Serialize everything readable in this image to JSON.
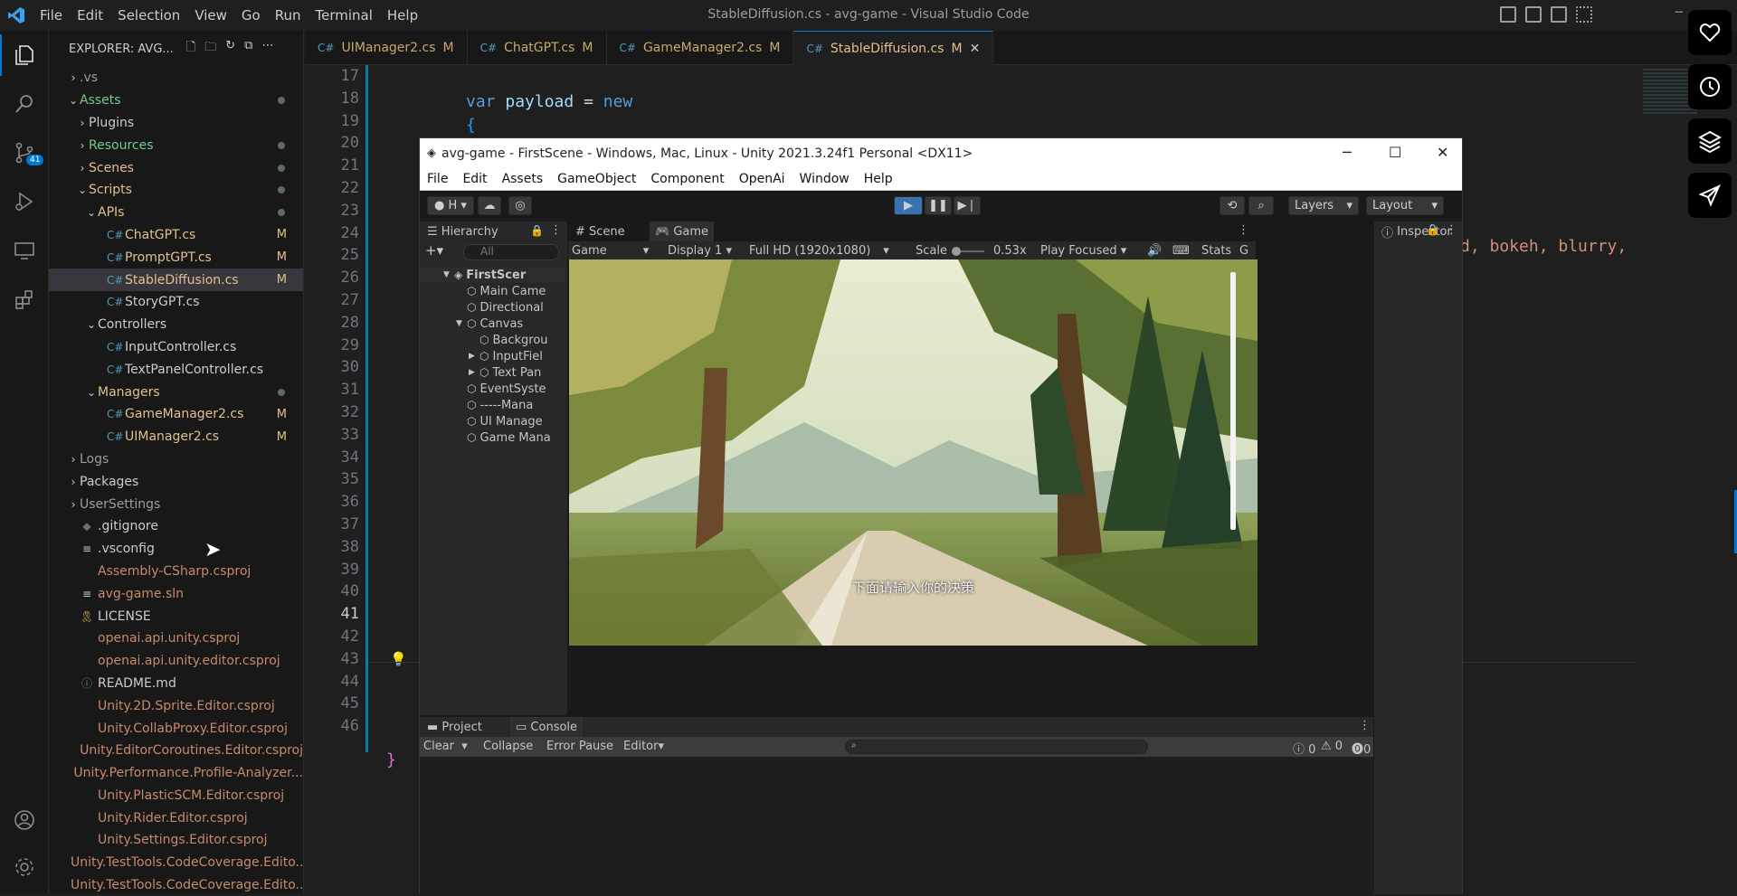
{
  "window": {
    "title": "StableDiffusion.cs - avg-game - Visual Studio Code",
    "menu": [
      "File",
      "Edit",
      "Selection",
      "View",
      "Go",
      "Run",
      "Terminal",
      "Help"
    ]
  },
  "activity": {
    "source_control_badge": "41"
  },
  "explorer": {
    "header": "EXPLORER: AVG...",
    "rows": [
      {
        "label": ".vs",
        "indent": 0,
        "chev": ">",
        "color": "#9d9d9d"
      },
      {
        "label": "Assets",
        "indent": 0,
        "chev": "v",
        "color": "#73c991",
        "dot": true
      },
      {
        "label": "Plugins",
        "indent": 1,
        "chev": ">",
        "color": "#cccccc"
      },
      {
        "label": "Resources",
        "indent": 1,
        "chev": ">",
        "color": "#73c991",
        "dot": true
      },
      {
        "label": "Scenes",
        "indent": 1,
        "chev": ">",
        "color": "#e2c08d",
        "dot": true
      },
      {
        "label": "Scripts",
        "indent": 1,
        "chev": "v",
        "color": "#e2c08d",
        "dot": true
      },
      {
        "label": "APIs",
        "indent": 2,
        "chev": "v",
        "color": "#e2c08d",
        "dot": true
      },
      {
        "label": "ChatGPT.cs",
        "indent": 3,
        "file": "cs",
        "color": "#e2c08d",
        "status": "M"
      },
      {
        "label": "PromptGPT.cs",
        "indent": 3,
        "file": "cs",
        "color": "#e2c08d",
        "status": "M"
      },
      {
        "label": "StableDiffusion.cs",
        "indent": 3,
        "file": "cs",
        "color": "#e2c08d",
        "status": "M",
        "selected": true
      },
      {
        "label": "StoryGPT.cs",
        "indent": 3,
        "file": "cs",
        "color": "#cccccc"
      },
      {
        "label": "Controllers",
        "indent": 2,
        "chev": "v",
        "color": "#cccccc"
      },
      {
        "label": "InputController.cs",
        "indent": 3,
        "file": "cs",
        "color": "#cccccc"
      },
      {
        "label": "TextPanelController.cs",
        "indent": 3,
        "file": "cs",
        "color": "#cccccc"
      },
      {
        "label": "Managers",
        "indent": 2,
        "chev": "v",
        "color": "#e2c08d",
        "dot": true
      },
      {
        "label": "GameManager2.cs",
        "indent": 3,
        "file": "cs",
        "color": "#e2c08d",
        "status": "M"
      },
      {
        "label": "UIManager2.cs",
        "indent": 3,
        "file": "cs",
        "color": "#e2c08d",
        "status": "M"
      },
      {
        "label": "Logs",
        "indent": 0,
        "chev": ">",
        "color": "#9d9d9d"
      },
      {
        "label": "Packages",
        "indent": 0,
        "chev": ">",
        "color": "#cccccc"
      },
      {
        "label": "UserSettings",
        "indent": 0,
        "chev": ">",
        "color": "#9d9d9d"
      },
      {
        "label": ".gitignore",
        "indent": 0,
        "file": "git",
        "color": "#cccccc"
      },
      {
        "label": ".vsconfig",
        "indent": 0,
        "file": "txt",
        "color": "#cccccc"
      },
      {
        "label": "Assembly-CSharp.csproj",
        "indent": 0,
        "file": "proj",
        "color": "#c78a6a"
      },
      {
        "label": "avg-game.sln",
        "indent": 0,
        "file": "txt",
        "color": "#c78a6a"
      },
      {
        "label": "LICENSE",
        "indent": 0,
        "file": "lic",
        "color": "#cccccc"
      },
      {
        "label": "openai.api.unity.csproj",
        "indent": 0,
        "file": "proj",
        "color": "#c78a6a"
      },
      {
        "label": "openai.api.unity.editor.csproj",
        "indent": 0,
        "file": "proj",
        "color": "#c78a6a"
      },
      {
        "label": "README.md",
        "indent": 0,
        "file": "info",
        "color": "#cccccc"
      },
      {
        "label": "Unity.2D.Sprite.Editor.csproj",
        "indent": 0,
        "file": "proj",
        "color": "#c78a6a"
      },
      {
        "label": "Unity.CollabProxy.Editor.csproj",
        "indent": 0,
        "file": "proj",
        "color": "#c78a6a"
      },
      {
        "label": "Unity.EditorCoroutines.Editor.csproj",
        "indent": 0,
        "file": "proj",
        "color": "#c78a6a"
      },
      {
        "label": "Unity.Performance.Profile-Analyzer...",
        "indent": 0,
        "file": "proj",
        "color": "#c78a6a"
      },
      {
        "label": "Unity.PlasticSCM.Editor.csproj",
        "indent": 0,
        "file": "proj",
        "color": "#c78a6a"
      },
      {
        "label": "Unity.Rider.Editor.csproj",
        "indent": 0,
        "file": "proj",
        "color": "#c78a6a"
      },
      {
        "label": "Unity.Settings.Editor.csproj",
        "indent": 0,
        "file": "proj",
        "color": "#c78a6a"
      },
      {
        "label": "Unity.TestTools.CodeCoverage.Edito...",
        "indent": 0,
        "file": "proj",
        "color": "#c78a6a"
      },
      {
        "label": "Unity.TestTools.CodeCoverage.Edito...",
        "indent": 0,
        "file": "proj",
        "color": "#c78a6a"
      }
    ]
  },
  "tabs": [
    {
      "label": "UIManager2.cs",
      "mark": "M"
    },
    {
      "label": "ChatGPT.cs",
      "mark": "M"
    },
    {
      "label": "GameManager2.cs",
      "mark": "M"
    },
    {
      "label": "StableDiffusion.cs",
      "mark": "M",
      "active": true,
      "close": "✕"
    }
  ],
  "editor": {
    "line_numbers": [
      "17",
      "18",
      "19",
      "20",
      "21",
      "22",
      "23",
      "24",
      "25",
      "26",
      "27",
      "28",
      "29",
      "30",
      "31",
      "32",
      "33",
      "34",
      "35",
      "36",
      "37",
      "38",
      "39",
      "40",
      "41",
      "42",
      "43",
      "44",
      "45",
      "46"
    ],
    "current_line": "41",
    "code_line_18": {
      "kw": "var",
      "name": "payload",
      "eq": "=",
      "new": "new"
    },
    "code_line_19": "{",
    "code_line_24_tail": "d, bokeh, blurry,",
    "code_line_45": "}"
  },
  "unity": {
    "title": "avg-game - FirstScene - Windows, Mac, Linux - Unity 2021.3.24f1 Personal <DX11>",
    "menu": [
      "File",
      "Edit",
      "Assets",
      "GameObject",
      "Component",
      "OpenAi",
      "Window",
      "Help"
    ],
    "toolbar": {
      "account": "H",
      "layers": "Layers",
      "layout": "Layout"
    },
    "hierarchy": {
      "tab": "Hierarchy",
      "search_placeholder": "All",
      "items": [
        {
          "label": "FirstScer",
          "level": 0,
          "expanded": true,
          "root": true
        },
        {
          "label": "Main Came",
          "level": 1
        },
        {
          "label": "Directional",
          "level": 1
        },
        {
          "label": "Canvas",
          "level": 1,
          "expanded": true
        },
        {
          "label": "Backgrou",
          "level": 2
        },
        {
          "label": "InputFiel",
          "level": 2,
          "collapsed": true
        },
        {
          "label": "Text Pan",
          "level": 2,
          "collapsed": true
        },
        {
          "label": "EventSyste",
          "level": 1
        },
        {
          "label": "-----Mana",
          "level": 1
        },
        {
          "label": "UI Manage",
          "level": 1
        },
        {
          "label": "Game Mana",
          "level": 1
        }
      ]
    },
    "scene_tab": "Scene",
    "game_tab": "Game",
    "game_bar": {
      "view": "Game",
      "display": "Display 1",
      "resolution": "Full HD (1920x1080)",
      "scale_label": "Scale",
      "scale_value": "0.53x",
      "play_mode": "Play Focused",
      "stats": "Stats",
      "gizmos": "G"
    },
    "game_subtitle": "下面请输入你的决策",
    "inspector_tab": "Inspector",
    "project_tab": "Project",
    "console_tab": "Console",
    "console": {
      "clear": "Clear",
      "collapse": "Collapse",
      "error_pause": "Error Pause",
      "editor": "Editor",
      "count_info": "0",
      "count_warn": "0",
      "count_err": "0"
    }
  }
}
